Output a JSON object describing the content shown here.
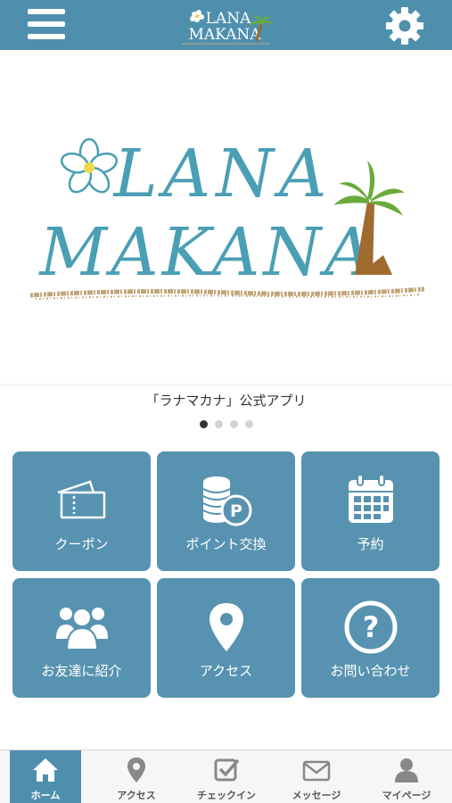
{
  "header": {
    "menu_icon": "hamburger-menu-icon",
    "logo_line1": "LANA",
    "logo_line2": "MAKANA",
    "settings_icon": "gear-icon"
  },
  "hero": {
    "logo_line1": "LANA",
    "logo_line2": "MAKANA",
    "colors": {
      "teal": "#4a9fb5",
      "palm_green": "#6aaa3a",
      "trunk_brown": "#a06b2e",
      "sand": "#c4a57a"
    }
  },
  "caption": "「ラナマカナ」公式アプリ",
  "carousel": {
    "count": 4,
    "active": 1
  },
  "menu": {
    "tiles": [
      {
        "label": "クーポン",
        "icon": "ticket-icon"
      },
      {
        "label": "ポイント交換",
        "icon": "coins-icon"
      },
      {
        "label": "予約",
        "icon": "calendar-icon"
      },
      {
        "label": "お友達に紹介",
        "icon": "people-icon"
      },
      {
        "label": "アクセス",
        "icon": "map-pin-icon"
      },
      {
        "label": "お問い合わせ",
        "icon": "question-icon"
      }
    ]
  },
  "tabbar": {
    "tabs": [
      {
        "label": "ホーム",
        "icon": "home-icon",
        "active": true
      },
      {
        "label": "アクセス",
        "icon": "map-pin-icon",
        "active": false
      },
      {
        "label": "チェックイン",
        "icon": "checkin-icon",
        "active": false
      },
      {
        "label": "メッセージ",
        "icon": "envelope-icon",
        "active": false
      },
      {
        "label": "マイページ",
        "icon": "user-icon",
        "active": false
      }
    ]
  },
  "colors": {
    "header_bg": "#4f8fae",
    "tile_bg": "#5793b0",
    "active_tab": "#4f8fae"
  }
}
